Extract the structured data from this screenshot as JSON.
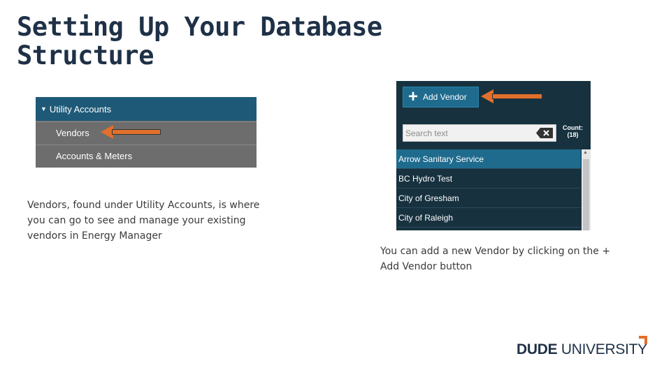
{
  "slide": {
    "title_line1": "Setting Up Your Database",
    "title_line2": "Structure",
    "caption_left": "Vendors, found under Utility Accounts, is where you can go to see and manage your existing vendors in Energy Manager",
    "caption_right": "You can add a new Vendor by clicking on the + Add Vendor button"
  },
  "menu": {
    "header_icon": "caret-down-icon",
    "header_label": "Utility Accounts",
    "items": [
      {
        "label": "Vendors"
      },
      {
        "label": "Accounts & Meters"
      }
    ]
  },
  "vendor_panel": {
    "add_button_icon": "plus-icon",
    "add_button_label": "Add Vendor",
    "search_placeholder": "Search text",
    "clear_icon": "clear-search-icon",
    "count_label": "Count:",
    "count_value": "(18)",
    "vendors": [
      {
        "name": "Arrow Sanitary Service",
        "selected": true
      },
      {
        "name": "BC Hydro Test",
        "selected": false
      },
      {
        "name": "City of Gresham",
        "selected": false
      },
      {
        "name": "City of Raleigh",
        "selected": false
      }
    ]
  },
  "logo": {
    "bold_text": "DUDE",
    "regular_text": " UNIVERSITY"
  },
  "colors": {
    "title": "#1f3147",
    "menu_header": "#1e5a78",
    "menu_item": "#6d6d6d",
    "panel_bg": "#17313f",
    "selected_row": "#1f6b8e",
    "arrow": "#e0702c",
    "logo_accent": "#e0702c"
  }
}
